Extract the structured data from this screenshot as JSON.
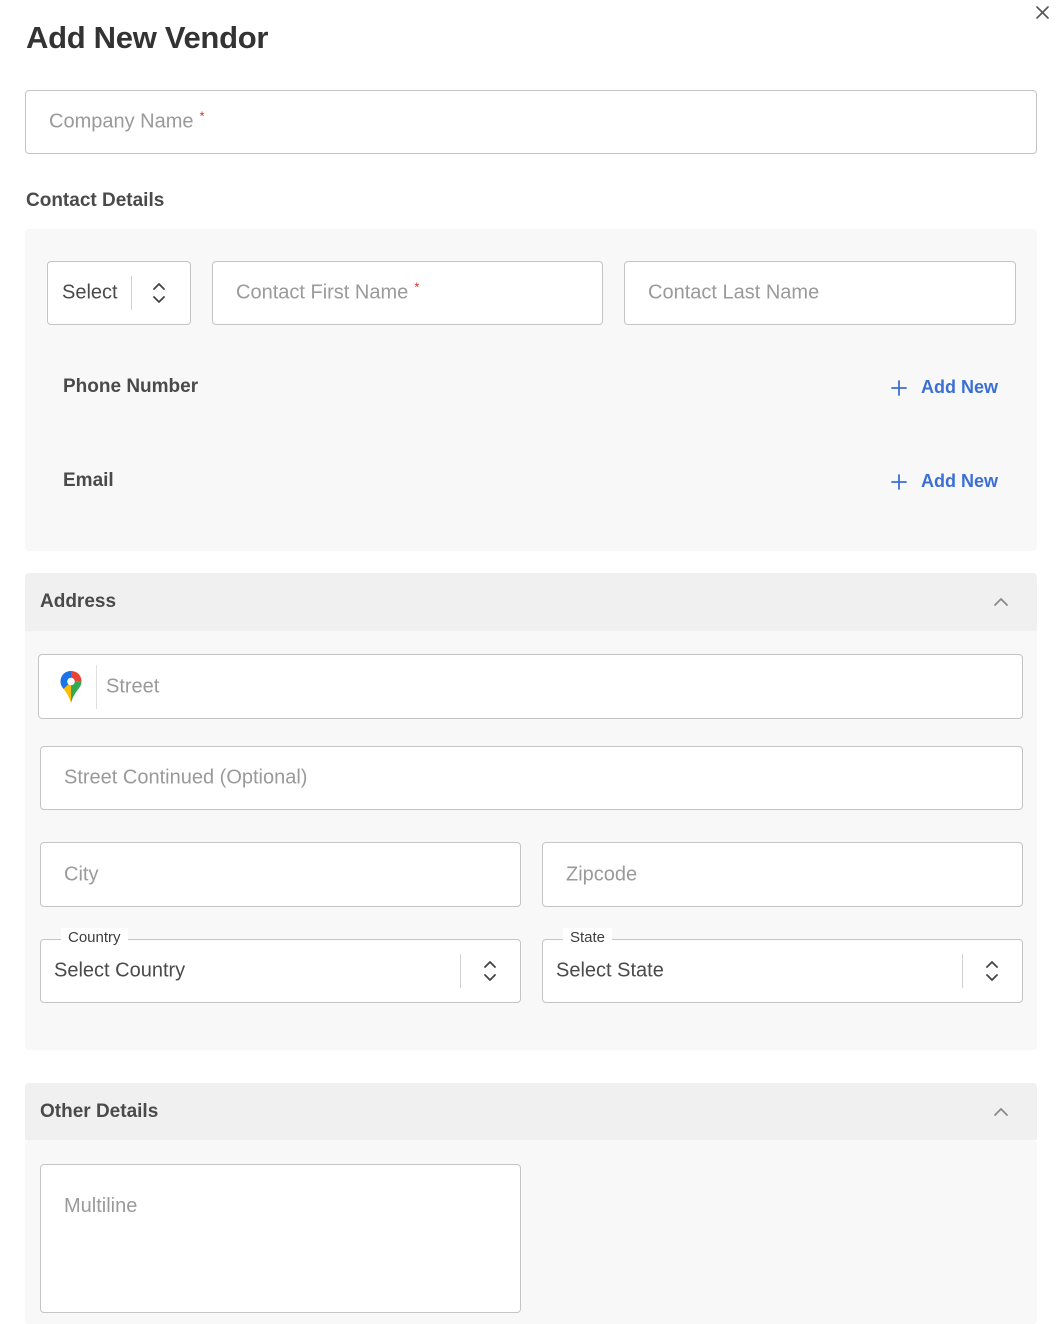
{
  "modal": {
    "title": "Add New Vendor"
  },
  "company": {
    "placeholder": "Company Name",
    "required_mark": "*"
  },
  "contact": {
    "section_label": "Contact Details",
    "prefix_select": "Select",
    "first_name_placeholder": "Contact First Name",
    "first_name_required": "*",
    "last_name_placeholder": "Contact Last Name",
    "phone_label": "Phone Number",
    "email_label": "Email",
    "add_new_label": "Add New"
  },
  "address": {
    "header": "Address",
    "street_placeholder": "Street",
    "street2_placeholder": "Street Continued (Optional)",
    "city_placeholder": "City",
    "zip_placeholder": "Zipcode",
    "country_legend": "Country",
    "country_value": "Select Country",
    "state_legend": "State",
    "state_value": "Select State"
  },
  "other": {
    "header": "Other Details",
    "multiline_placeholder": "Multiline"
  },
  "colors": {
    "accent": "#3b6fd4",
    "required": "#d32f2f",
    "panel_bg": "#f8f8f8",
    "header_bg": "#f0f0f0"
  }
}
